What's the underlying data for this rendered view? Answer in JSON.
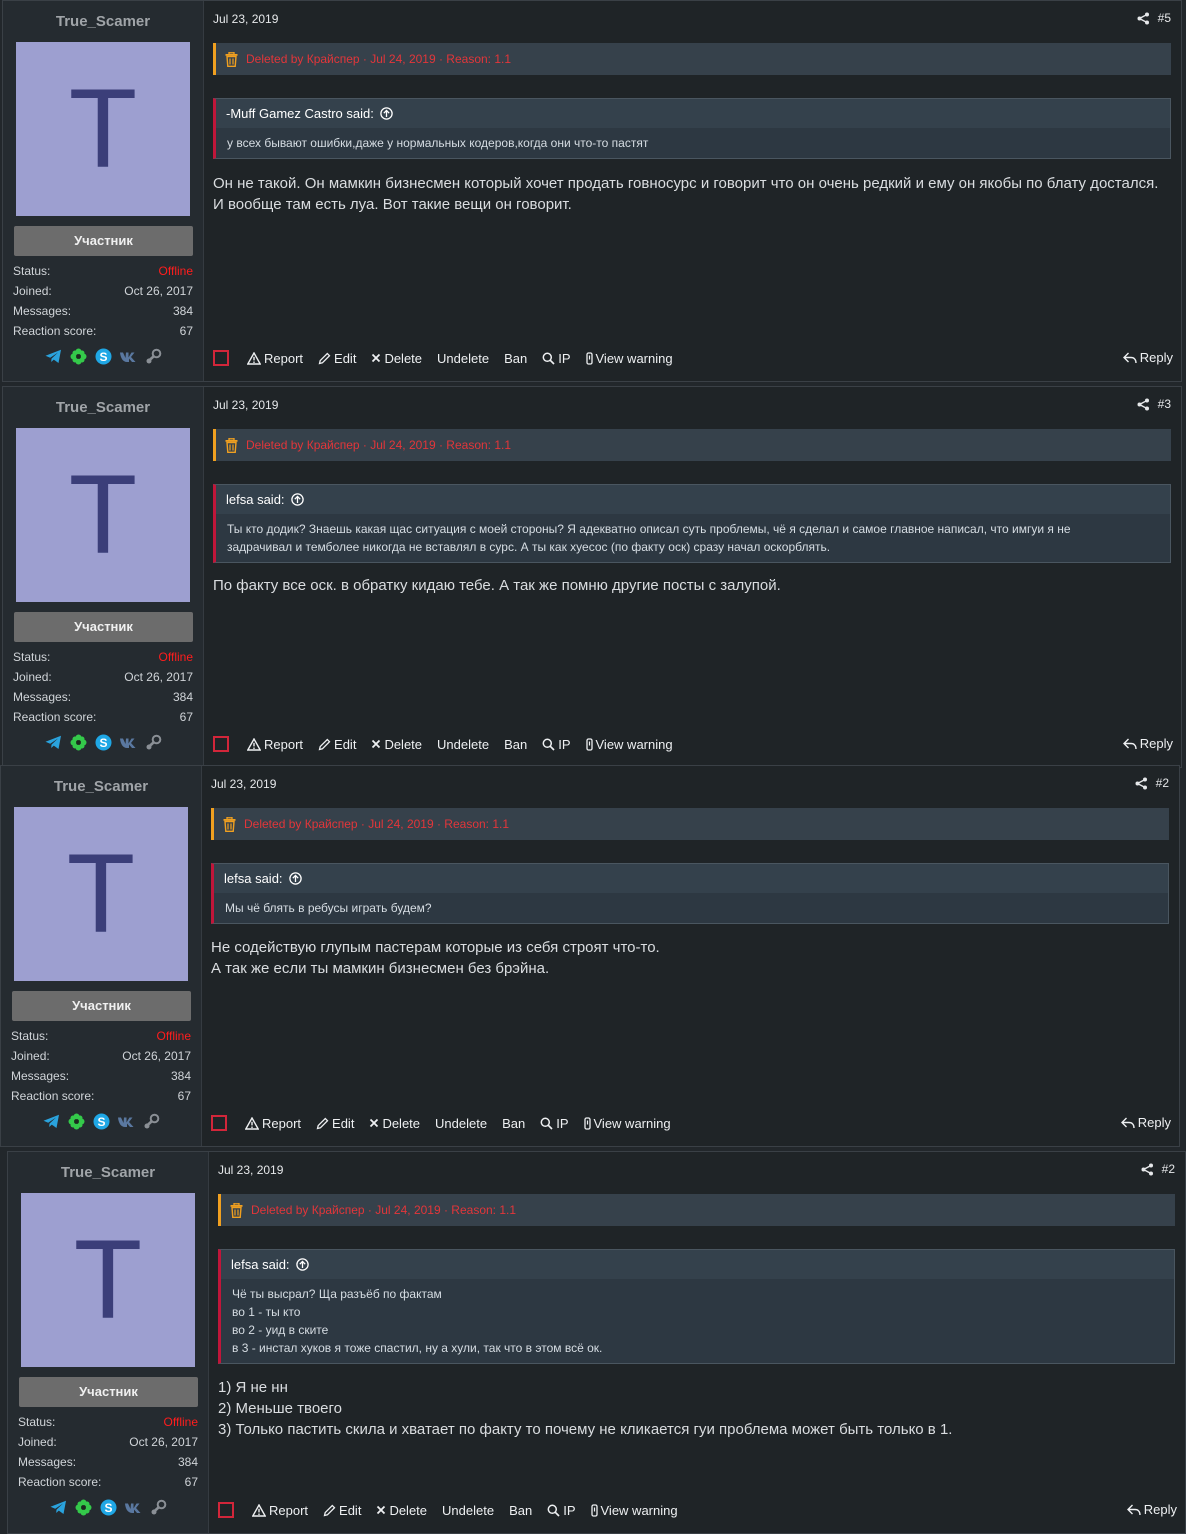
{
  "common": {
    "username": "True_Scamer",
    "avatar_letter": "T",
    "role": "Участник",
    "status_label": "Status:",
    "status_value": "Offline",
    "joined_label": "Joined:",
    "joined_value": "Oct 26, 2017",
    "messages_label": "Messages:",
    "messages_value": "384",
    "reaction_label": "Reaction score:",
    "reaction_value": "67",
    "social_icons": [
      "telegram-icon",
      "icq-icon",
      "skype-icon",
      "vk-icon",
      "steam-icon"
    ],
    "date": "Jul 23, 2019",
    "deleted_text": "Deleted by Крайспер · Jul 24, 2019 · Reason: 1.1",
    "said_suffix": " said:",
    "actions": {
      "report": "Report",
      "edit": "Edit",
      "delete": "Delete",
      "undelete": "Undelete",
      "ban": "Ban",
      "ip": "IP",
      "view_warning": "View warning",
      "reply": "Reply"
    }
  },
  "colors": {
    "offline": "#ff1d1d",
    "deleted_text": "#e2363a",
    "trash_icon": "#f0a020",
    "quote_border": "#c0163a",
    "avatar_bg": "#9d9fd0",
    "avatar_letter": "#3b3e79"
  },
  "posts": [
    {
      "number": "#5",
      "quote_author": "-Muff Gamez Castro",
      "quote_lines": [
        "у всех бывают ошибки,даже у нормальных кодеров,когда они что-то пастят"
      ],
      "body_lines": [
        "Он не такой. Он мамкин бизнесмен который хочет продать говносурс и говорит что он очень редкий и ему он якобы по блату достался.",
        "И вообще там есть луа. Вот такие вещи он говорит."
      ]
    },
    {
      "number": "#3",
      "quote_author": "lefsa",
      "quote_lines": [
        "Ты кто додик? Знаешь какая щас ситуация с моей стороны? Я адекватно описал суть проблемы, чё я сделал и самое главное написал, что имгуи я не",
        "задрачивал и темболее никогда не вставлял в сурс. А ты как хуесос (по факту оск) сразу начал оскорблять."
      ],
      "body_lines": [
        "По факту все оск. в обратку кидаю тебе. А так же помню другие посты с залупой."
      ]
    },
    {
      "number": "#2",
      "quote_author": "lefsa",
      "quote_lines": [
        "Мы чё блять в ребусы играть будем?"
      ],
      "body_lines": [
        "Не содействую глупым пастерам которые из себя строят что-то.",
        "А так же если ты мамкин бизнесмен без брэйна."
      ]
    },
    {
      "number": "#2",
      "quote_author": "lefsa",
      "quote_lines": [
        "Чё ты высрал? Ща разъёб по фактам",
        "во 1 - ты кто",
        "во 2 - уид в ските",
        "в 3 - инстал хуков я тоже спастил, ну а хули, так что в этом всё ок."
      ],
      "body_lines": [
        "1) Я не нн",
        "2) Меньше твоего",
        "3) Только пастить скила и хватает по факту то почему не кликается гуи проблема может быть только в 1."
      ]
    }
  ]
}
